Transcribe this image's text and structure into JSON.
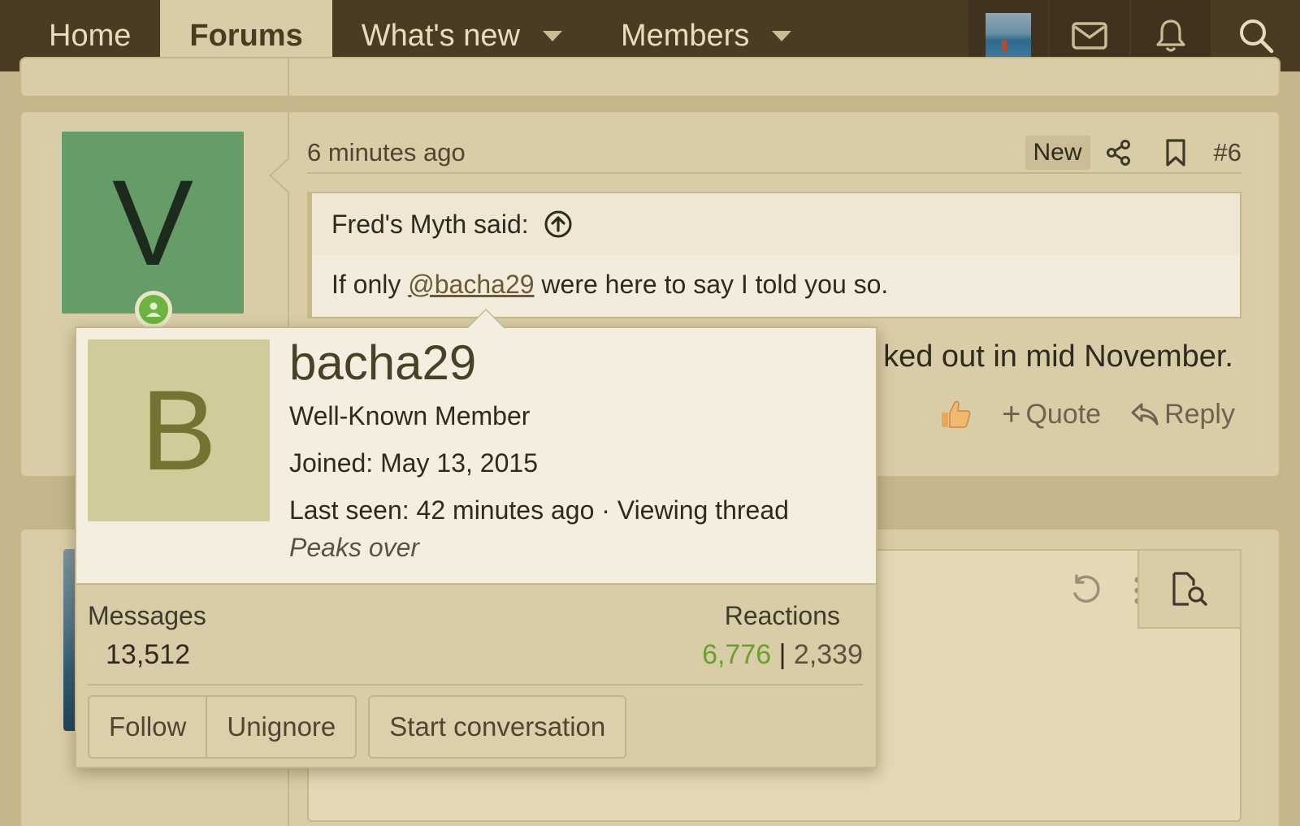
{
  "nav": {
    "tabs": [
      {
        "label": "Home"
      },
      {
        "label": "Forums"
      },
      {
        "label": "What's new"
      },
      {
        "label": "Members"
      }
    ],
    "icons": [
      "avatar-thumb",
      "mail-icon",
      "bell-icon",
      "search-icon"
    ]
  },
  "post": {
    "author_initial": "V",
    "time": "6 minutes ago",
    "badge": "New",
    "number": "#6",
    "quote": {
      "author_said": "Fred's Myth said:",
      "before": "If only ",
      "mention": "@bacha29",
      "after": " were here to say I told you so."
    },
    "body_visible": "ked out in mid November.",
    "footer": {
      "quote_label": "Quote",
      "reply_label": "Reply"
    }
  },
  "member_tooltip": {
    "initial": "B",
    "username": "bacha29",
    "title": "Well-Known Member",
    "joined_label": "Joined:",
    "joined_value": "May 13, 2015",
    "last_seen_label": "Last seen:",
    "last_seen_value": "42 minutes ago · Viewing thread",
    "status": "Peaks over",
    "messages_label": "Messages",
    "messages_value": "13,512",
    "reactions_label": "Reactions",
    "reactions_positive": "6,776",
    "reactions_separator": " | ",
    "reactions_other": "2,339",
    "buttons": {
      "follow": "Follow",
      "unignore": "Unignore",
      "start_conversation": "Start conversation"
    }
  },
  "colors": {
    "nav_bg": "#4a3c22",
    "page_bg": "#c4b68a",
    "panel_bg": "#d9cda7",
    "accent_green": "#6aa02b"
  }
}
